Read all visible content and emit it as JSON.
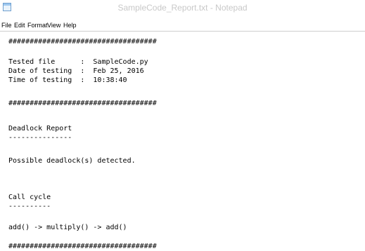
{
  "window": {
    "title": "SampleCode_Report.txt - Notepad",
    "icon": "notepad-icon"
  },
  "menu": {
    "file": "File",
    "edit": "Edit",
    "format": "Format",
    "view": "View",
    "help": "Help"
  },
  "document": {
    "lines": [
      "###################################",
      "",
      "Tested file      :  SampleCode.py",
      "Date of testing  :  Feb 25, 2016",
      "Time of testing  :  10:38:40",
      "",
      "###################################",
      "",
      "Deadlock Report",
      "---------------",
      "",
      "Possible deadlock(s) detected.",
      "",
      "",
      "Call cycle",
      "----------",
      "",
      "add() -> multiply() -> add()",
      "",
      "###################################"
    ]
  },
  "colors": {
    "title_text": "#c8c8c8",
    "text": "#000000",
    "background": "#ffffff"
  }
}
